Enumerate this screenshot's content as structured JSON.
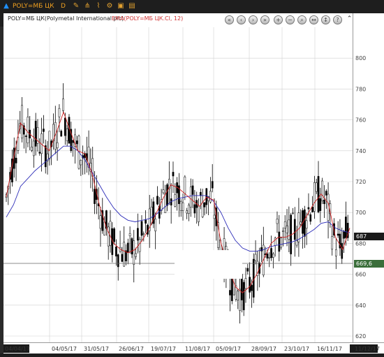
{
  "toolbar": {
    "symbol": "POLY=МБ ЦК",
    "timeframe": "D"
  },
  "chart_header": {
    "title": "POLY=МБ ЦК(Polymetal International plc)",
    "ema_label": "EMA(POLY=МБ ЦК.Cl, 12)"
  },
  "price_tags": {
    "last": "687",
    "cursor": "669,6"
  },
  "colors": {
    "candles": "#000000",
    "ema12": "#d02020",
    "ema_long": "#2020b0",
    "background": "#ffffff"
  },
  "chart_data": {
    "type": "candlestick",
    "title": "POLY=МБ ЦК(Polymetal International plc)",
    "ylim": [
      620,
      820
    ],
    "y_ticks": [
      620,
      640,
      660,
      680,
      700,
      720,
      740,
      760,
      780,
      800
    ],
    "x_ticks": [
      "04/04/17",
      "04/05/17",
      "31/05/17",
      "26/06/17",
      "19/07/17",
      "11/08/17",
      "05/09/17",
      "28/09/17",
      "23/10/17",
      "16/11/17",
      "11/12/17"
    ],
    "series": [
      {
        "name": "EMA(POLY=МБ ЦК.Cl, 12)",
        "values": [
          710,
          735,
          758,
          752,
          748,
          744,
          740,
          752,
          765,
          752,
          740,
          738,
          725,
          705,
          690,
          680,
          676,
          674,
          676,
          682,
          690,
          700,
          710,
          718,
          716,
          712,
          708,
          704,
          710,
          708,
          680,
          665,
          652,
          648,
          652,
          660,
          670,
          680,
          684,
          684,
          686,
          690,
          698,
          706,
          712,
          706,
          684,
          676,
          690
        ]
      },
      {
        "name": "EMA long",
        "values": [
          697,
          705,
          717,
          722,
          727,
          731,
          735,
          739,
          743,
          743,
          740,
          734,
          726,
          718,
          710,
          703,
          698,
          695,
          694,
          695,
          696,
          699,
          703,
          707,
          709,
          710,
          711,
          711,
          711,
          707,
          700,
          690,
          682,
          677,
          675,
          675,
          676,
          678,
          679,
          680,
          681,
          683,
          686,
          689,
          693,
          694,
          690,
          688,
          687
        ]
      }
    ]
  }
}
